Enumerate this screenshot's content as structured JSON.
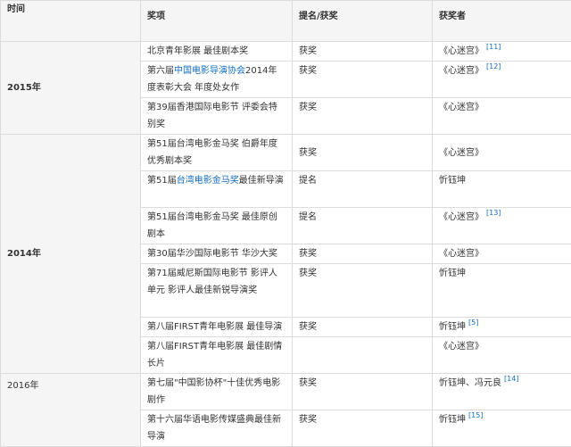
{
  "header": {
    "year": "时间",
    "award": "奖项",
    "status": "提名/获奖",
    "winner": "获奖者"
  },
  "groups": [
    {
      "year": "2015年",
      "rows": [
        {
          "award_pre": "北京青年影展 最佳剧本奖",
          "award_link": "",
          "award_post": "",
          "status": "获奖",
          "winner": "《心迷宫》",
          "ref": "[11]"
        },
        {
          "award_pre": "第六届",
          "award_link": "中国电影导演协会",
          "award_post": "2014年度表彰大会 年度处女作",
          "status": "获奖",
          "winner": "《心迷宫》",
          "ref": "[12]"
        },
        {
          "award_pre": "第39届香港国际电影节 评委会特别奖",
          "award_link": "",
          "award_post": "",
          "status": "获奖",
          "winner": "《心迷宫》",
          "ref": ""
        }
      ]
    },
    {
      "year": "2014年",
      "rows": [
        {
          "award_pre": "第51届台湾电影金马奖 伯爵年度优秀剧本奖",
          "award_link": "",
          "award_post": "",
          "status": "获奖",
          "winner": "《心迷宫》",
          "ref": ""
        },
        {
          "award_pre": "第51届",
          "award_link": "台湾电影金马奖",
          "award_post": "最佳新导演",
          "status": "提名",
          "winner": "忻钰坤",
          "ref": ""
        },
        {
          "award_pre": "第51届台湾电影金马奖 最佳原创剧本",
          "award_link": "",
          "award_post": "",
          "status": "提名",
          "winner": "《心迷宫》",
          "ref": "[13]"
        },
        {
          "award_pre": "第30届华沙国际电影节 华沙大奖",
          "award_link": "",
          "award_post": "",
          "status": "获奖",
          "winner": "《心迷宫》",
          "ref": ""
        },
        {
          "award_pre": "第71届威尼斯国际电影节 影评人单元 影评人最佳新锐导演奖",
          "award_link": "",
          "award_post": "",
          "status": "获奖",
          "winner": "忻钰坤",
          "ref": ""
        },
        {
          "award_pre": "第八届FIRST青年电影展 最佳导演",
          "award_link": "",
          "award_post": "",
          "status": "获奖",
          "winner": "忻钰坤",
          "ref": "[5]"
        },
        {
          "award_pre": "第八届FIRST青年电影展 最佳剧情长片",
          "award_link": "",
          "award_post": "",
          "status": "",
          "winner": "《心迷宫》",
          "ref": ""
        }
      ]
    },
    {
      "year": "2016年",
      "rows": [
        {
          "award_pre": "第七届\"中国影协杯\"十佳优秀电影剧作",
          "award_link": "",
          "award_post": "",
          "status": "获奖",
          "winner": "忻钰坤、冯元良",
          "ref": "[14]"
        },
        {
          "award_pre": "第十六届华语电影传媒盛典最佳新导演",
          "award_link": "",
          "award_post": "",
          "status": "获奖",
          "winner": "忻钰坤",
          "ref": "[15]"
        }
      ]
    }
  ]
}
